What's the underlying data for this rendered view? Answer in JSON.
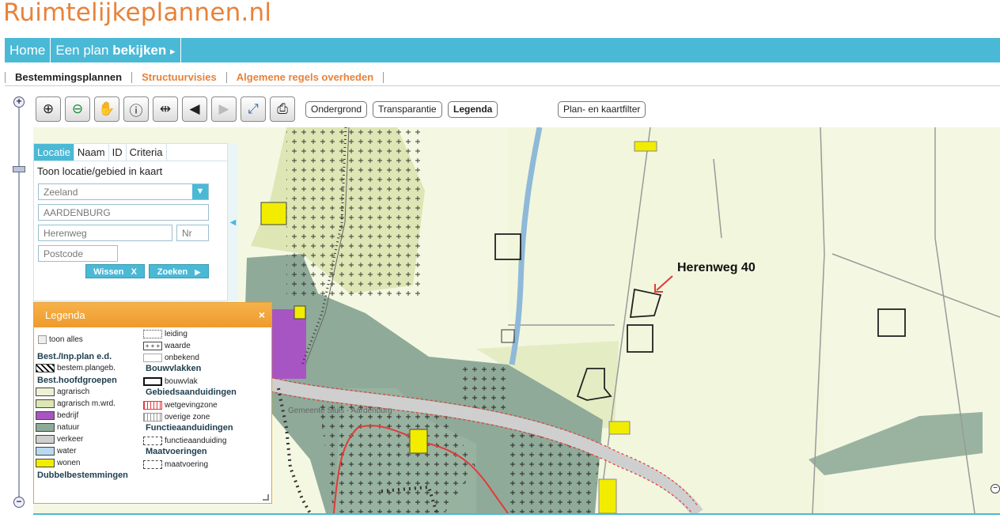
{
  "logo": "Ruimtelijkeplannen.nl",
  "nav": {
    "home": "Home",
    "plan_prefix": "Een plan",
    "plan_bold": "bekijken",
    "plan_arrow": "▸"
  },
  "subnav": [
    "Bestemmingsplannen",
    "Structuurvisies",
    "Algemene regels overheden"
  ],
  "zoom": {
    "plus": "+",
    "minus": "−"
  },
  "toolbar": {
    "tools": [
      {
        "icon": "zoom-in-icon",
        "glyph": "⊕"
      },
      {
        "icon": "zoom-out-icon",
        "glyph": "⊖"
      },
      {
        "icon": "pan-hand-icon",
        "glyph": "✋"
      },
      {
        "icon": "info-icon",
        "glyph": "ⓘ"
      },
      {
        "icon": "measure-icon",
        "glyph": "⇹"
      },
      {
        "icon": "back-icon",
        "glyph": "◀"
      },
      {
        "icon": "forward-icon",
        "glyph": "▶"
      },
      {
        "icon": "full-extent-icon",
        "glyph": "⤢"
      },
      {
        "icon": "print-icon",
        "glyph": "⎙"
      }
    ],
    "ondergrond": "Ondergrond",
    "transparantie": "Transparantie",
    "legenda": "Legenda",
    "filter": "Plan- en kaartfilter"
  },
  "search": {
    "tabs": [
      "Locatie",
      "Naam",
      "ID",
      "Criteria"
    ],
    "title": "Toon locatie/gebied in kaart",
    "province": "Zeeland",
    "place": "AARDENBURG",
    "street": "Herenweg",
    "number_placeholder": "Nr",
    "postcode_placeholder": "Postcode",
    "clear_label": "Wissen",
    "clear_icon": "X",
    "search_label": "Zoeken",
    "search_icon": "▶"
  },
  "map": {
    "annotation": "Herenweg 40",
    "road_label": "Gemeente Sluis - Aardenburg"
  },
  "legend": {
    "title": "Legenda",
    "close": "×",
    "show_all": "toon alles",
    "h_bestplan": "Best./Inp.plan e.d.",
    "bestem_plangeb": "bestem.plangeb.",
    "h_hoofdgroepen": "Best.hoofdgroepen",
    "agrarisch": "agrarisch",
    "agrarisch_mwrd": "agrarisch m.wrd.",
    "bedrijf": "bedrijf",
    "natuur": "natuur",
    "verkeer": "verkeer",
    "water": "water",
    "wonen": "wonen",
    "h_dubbel": "Dubbelbestemmingen",
    "leiding": "leiding",
    "waarde": "waarde",
    "onbekend": "onbekend",
    "h_bouwvlakken": "Bouwvlakken",
    "bouwvlak": "bouwvlak",
    "h_gebied": "Gebiedsaanduidingen",
    "wetgevingzone": "wetgevingzone",
    "overige_zone": "overige zone",
    "h_functie": "Functieaanduidingen",
    "functieaanduiding": "functieaanduiding",
    "h_maat": "Maatvoeringen",
    "maatvoering": "maatvoering"
  },
  "colors": {
    "brand_orange": "#e8823a",
    "nav_blue": "#4ab9d6",
    "agrarisch": "#eef1d6",
    "agrarisch_mwrd": "#dde6b4",
    "bedrijf": "#a755c2",
    "natuur": "#8faa98",
    "verkeer": "#cfcfcf",
    "water": "#b9d9ee",
    "wonen": "#f2ec00",
    "wetgevingzone": "#e23a3a"
  }
}
